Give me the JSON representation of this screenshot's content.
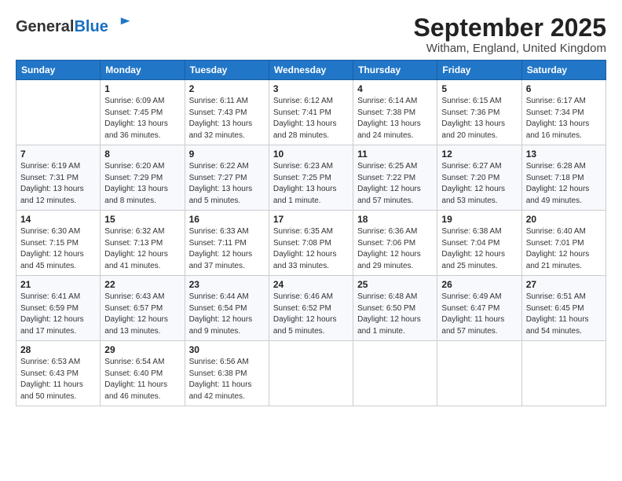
{
  "logo": {
    "general": "General",
    "blue": "Blue"
  },
  "title": "September 2025",
  "location": "Witham, England, United Kingdom",
  "days_of_week": [
    "Sunday",
    "Monday",
    "Tuesday",
    "Wednesday",
    "Thursday",
    "Friday",
    "Saturday"
  ],
  "weeks": [
    [
      {
        "day": "",
        "info": ""
      },
      {
        "day": "1",
        "info": "Sunrise: 6:09 AM\nSunset: 7:45 PM\nDaylight: 13 hours\nand 36 minutes."
      },
      {
        "day": "2",
        "info": "Sunrise: 6:11 AM\nSunset: 7:43 PM\nDaylight: 13 hours\nand 32 minutes."
      },
      {
        "day": "3",
        "info": "Sunrise: 6:12 AM\nSunset: 7:41 PM\nDaylight: 13 hours\nand 28 minutes."
      },
      {
        "day": "4",
        "info": "Sunrise: 6:14 AM\nSunset: 7:38 PM\nDaylight: 13 hours\nand 24 minutes."
      },
      {
        "day": "5",
        "info": "Sunrise: 6:15 AM\nSunset: 7:36 PM\nDaylight: 13 hours\nand 20 minutes."
      },
      {
        "day": "6",
        "info": "Sunrise: 6:17 AM\nSunset: 7:34 PM\nDaylight: 13 hours\nand 16 minutes."
      }
    ],
    [
      {
        "day": "7",
        "info": "Sunrise: 6:19 AM\nSunset: 7:31 PM\nDaylight: 13 hours\nand 12 minutes."
      },
      {
        "day": "8",
        "info": "Sunrise: 6:20 AM\nSunset: 7:29 PM\nDaylight: 13 hours\nand 8 minutes."
      },
      {
        "day": "9",
        "info": "Sunrise: 6:22 AM\nSunset: 7:27 PM\nDaylight: 13 hours\nand 5 minutes."
      },
      {
        "day": "10",
        "info": "Sunrise: 6:23 AM\nSunset: 7:25 PM\nDaylight: 13 hours\nand 1 minute."
      },
      {
        "day": "11",
        "info": "Sunrise: 6:25 AM\nSunset: 7:22 PM\nDaylight: 12 hours\nand 57 minutes."
      },
      {
        "day": "12",
        "info": "Sunrise: 6:27 AM\nSunset: 7:20 PM\nDaylight: 12 hours\nand 53 minutes."
      },
      {
        "day": "13",
        "info": "Sunrise: 6:28 AM\nSunset: 7:18 PM\nDaylight: 12 hours\nand 49 minutes."
      }
    ],
    [
      {
        "day": "14",
        "info": "Sunrise: 6:30 AM\nSunset: 7:15 PM\nDaylight: 12 hours\nand 45 minutes."
      },
      {
        "day": "15",
        "info": "Sunrise: 6:32 AM\nSunset: 7:13 PM\nDaylight: 12 hours\nand 41 minutes."
      },
      {
        "day": "16",
        "info": "Sunrise: 6:33 AM\nSunset: 7:11 PM\nDaylight: 12 hours\nand 37 minutes."
      },
      {
        "day": "17",
        "info": "Sunrise: 6:35 AM\nSunset: 7:08 PM\nDaylight: 12 hours\nand 33 minutes."
      },
      {
        "day": "18",
        "info": "Sunrise: 6:36 AM\nSunset: 7:06 PM\nDaylight: 12 hours\nand 29 minutes."
      },
      {
        "day": "19",
        "info": "Sunrise: 6:38 AM\nSunset: 7:04 PM\nDaylight: 12 hours\nand 25 minutes."
      },
      {
        "day": "20",
        "info": "Sunrise: 6:40 AM\nSunset: 7:01 PM\nDaylight: 12 hours\nand 21 minutes."
      }
    ],
    [
      {
        "day": "21",
        "info": "Sunrise: 6:41 AM\nSunset: 6:59 PM\nDaylight: 12 hours\nand 17 minutes."
      },
      {
        "day": "22",
        "info": "Sunrise: 6:43 AM\nSunset: 6:57 PM\nDaylight: 12 hours\nand 13 minutes."
      },
      {
        "day": "23",
        "info": "Sunrise: 6:44 AM\nSunset: 6:54 PM\nDaylight: 12 hours\nand 9 minutes."
      },
      {
        "day": "24",
        "info": "Sunrise: 6:46 AM\nSunset: 6:52 PM\nDaylight: 12 hours\nand 5 minutes."
      },
      {
        "day": "25",
        "info": "Sunrise: 6:48 AM\nSunset: 6:50 PM\nDaylight: 12 hours\nand 1 minute."
      },
      {
        "day": "26",
        "info": "Sunrise: 6:49 AM\nSunset: 6:47 PM\nDaylight: 11 hours\nand 57 minutes."
      },
      {
        "day": "27",
        "info": "Sunrise: 6:51 AM\nSunset: 6:45 PM\nDaylight: 11 hours\nand 54 minutes."
      }
    ],
    [
      {
        "day": "28",
        "info": "Sunrise: 6:53 AM\nSunset: 6:43 PM\nDaylight: 11 hours\nand 50 minutes."
      },
      {
        "day": "29",
        "info": "Sunrise: 6:54 AM\nSunset: 6:40 PM\nDaylight: 11 hours\nand 46 minutes."
      },
      {
        "day": "30",
        "info": "Sunrise: 6:56 AM\nSunset: 6:38 PM\nDaylight: 11 hours\nand 42 minutes."
      },
      {
        "day": "",
        "info": ""
      },
      {
        "day": "",
        "info": ""
      },
      {
        "day": "",
        "info": ""
      },
      {
        "day": "",
        "info": ""
      }
    ]
  ]
}
